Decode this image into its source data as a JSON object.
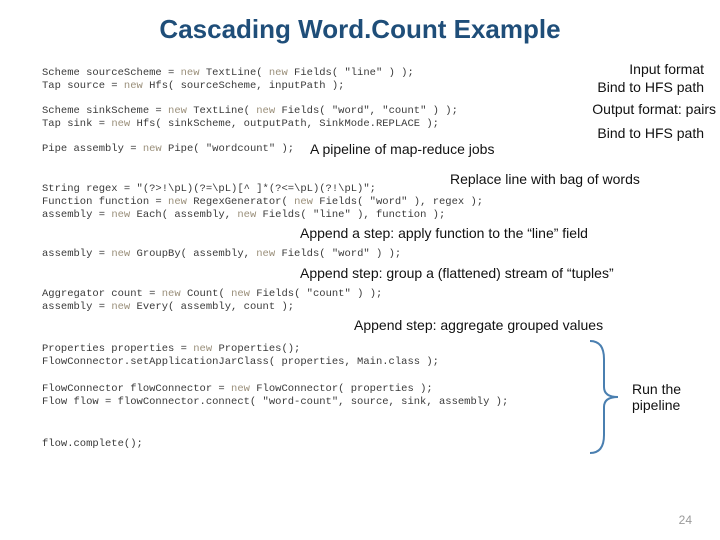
{
  "title": "Cascading Word.Count Example",
  "page_number": "24",
  "code": {
    "line01a": "Scheme sourceScheme = ",
    "line01b": "new",
    "line01c": " TextLine( ",
    "line01d": "new",
    "line01e": " Fields( \"line\" ) );",
    "line02a": "Tap source = ",
    "line02b": "new",
    "line02c": " Hfs( sourceScheme, inputPath );",
    "line03a": "Scheme sinkScheme = ",
    "line03b": "new",
    "line03c": " TextLine( ",
    "line03d": "new",
    "line03e": " Fields( \"word\", \"count\" ) );",
    "line04a": "Tap sink = ",
    "line04b": "new",
    "line04c": " Hfs( sinkScheme, outputPath, SinkMode.REPLACE );",
    "line05a": "Pipe assembly = ",
    "line05b": "new",
    "line05c": " Pipe( \"wordcount\" );",
    "line06": "String regex = \"(?>!\\pL)(?=\\pL)[^ ]*(?<=\\pL)(?!\\pL)\";",
    "line07a": "Function function = ",
    "line07b": "new",
    "line07c": " RegexGenerator( ",
    "line07d": "new",
    "line07e": " Fields( \"word\" ), regex );",
    "line08a": "assembly = ",
    "line08b": "new",
    "line08c": " Each( assembly, ",
    "line08d": "new",
    "line08e": " Fields( \"line\" ), function );",
    "line09a": "assembly = ",
    "line09b": "new",
    "line09c": " GroupBy( assembly, ",
    "line09d": "new",
    "line09e": " Fields( \"word\" ) );",
    "line10a": "Aggregator count = ",
    "line10b": "new",
    "line10c": " Count( ",
    "line10d": "new",
    "line10e": " Fields( \"count\" ) );",
    "line11a": "assembly = ",
    "line11b": "new",
    "line11c": " Every( assembly, count );",
    "line12a": "Properties properties = ",
    "line12b": "new",
    "line12c": " Properties();",
    "line13": "FlowConnector.setApplicationJarClass( properties, Main.class );",
    "line14a": "FlowConnector flowConnector = ",
    "line14b": "new",
    "line14c": " FlowConnector( properties );",
    "line15": "Flow flow = flowConnector.connect( \"word-count\", source, sink, assembly );",
    "line16": "flow.complete();"
  },
  "labels": {
    "input_format": "Input format",
    "bind_hfs_1": "Bind to HFS path",
    "output_format": "Output format: pairs",
    "bind_hfs_2": "Bind to HFS path",
    "pipeline": "A pipeline of map-reduce jobs",
    "replace_line": "Replace line with bag of words",
    "append_func": "Append a step: apply function to the “line” field",
    "append_group": "Append step: group a (flattened) stream of “tuples”",
    "append_agg": "Append step: aggregate grouped values",
    "run1": "Run the",
    "run2": "pipeline"
  }
}
